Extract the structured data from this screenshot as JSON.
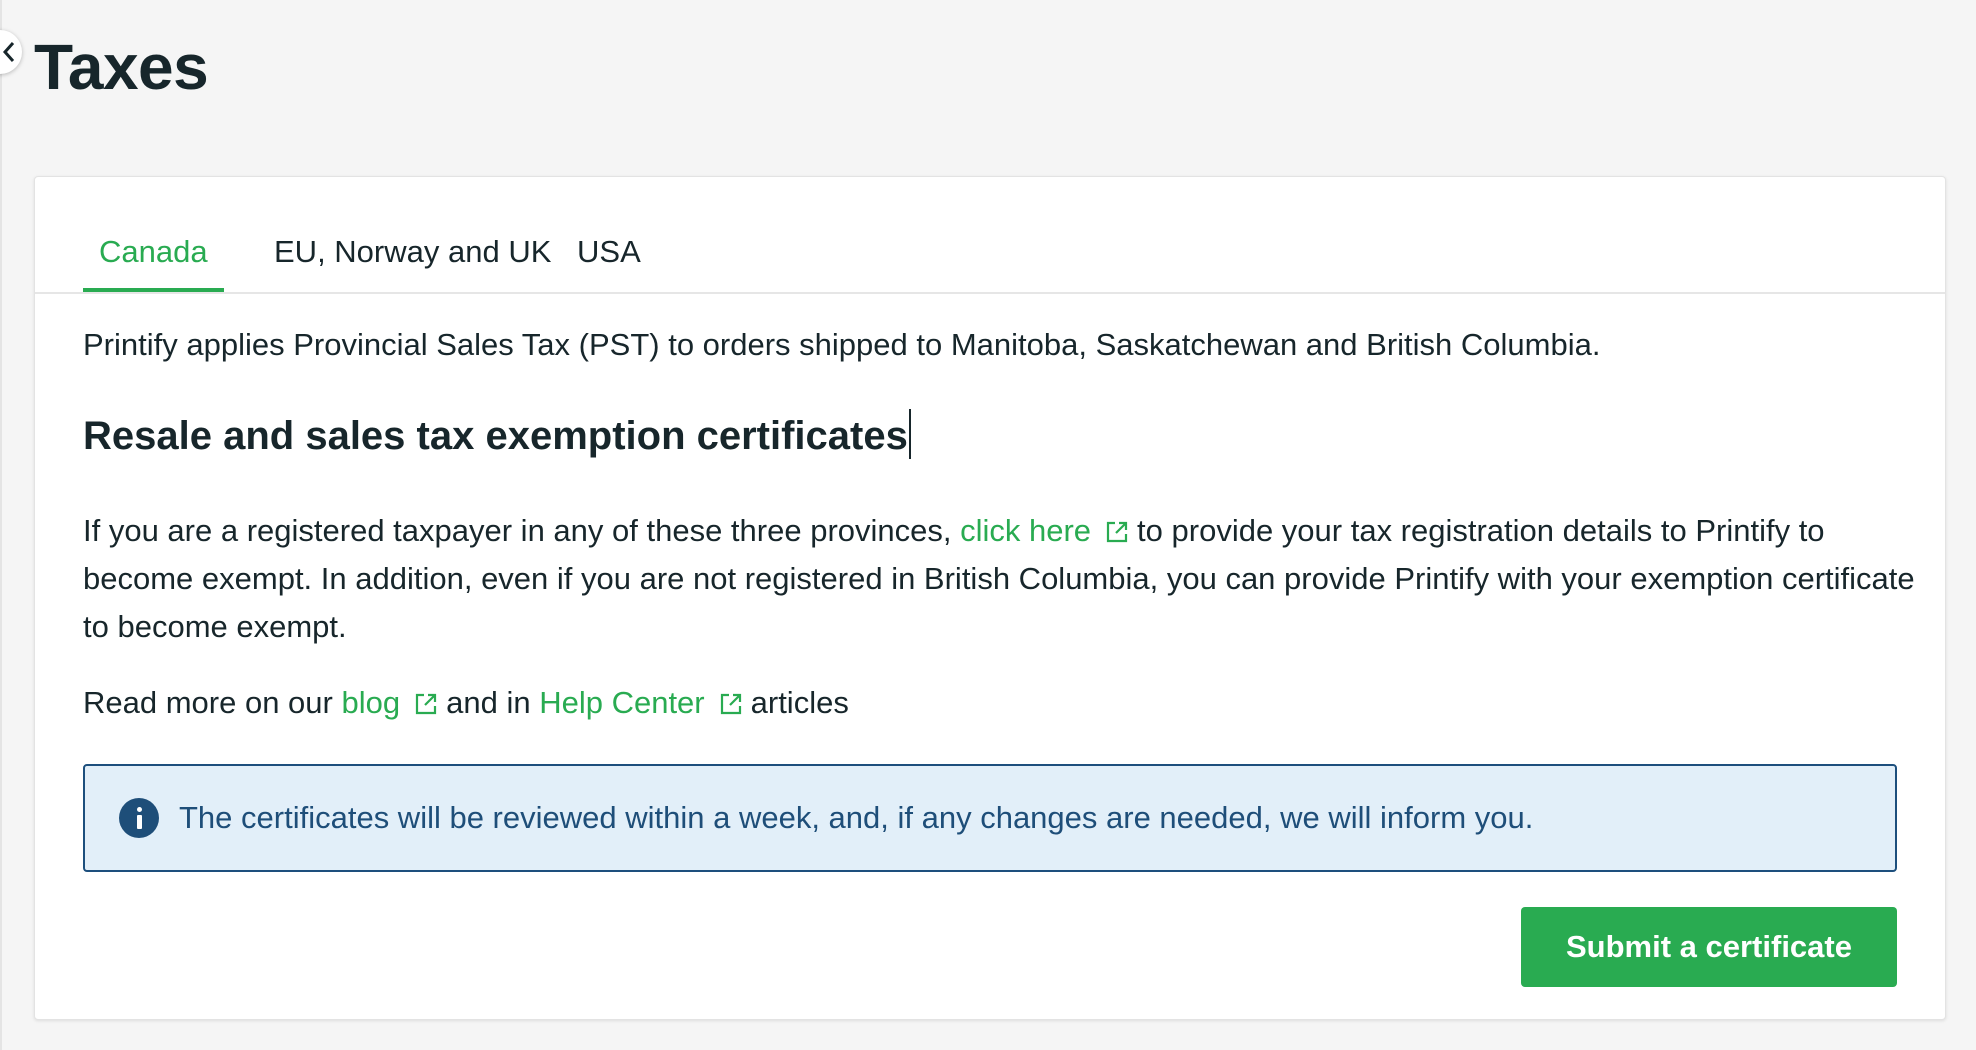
{
  "page": {
    "title": "Taxes"
  },
  "tabs": [
    {
      "label": "Canada",
      "active": true
    },
    {
      "label": "EU, Norway and UK",
      "active": false
    },
    {
      "label": "USA",
      "active": false
    }
  ],
  "content": {
    "intro": "Printify applies Provincial Sales Tax (PST) to orders shipped to Manitoba, Saskatchewan and British Columbia.",
    "section_title": "Resale and sales tax exemption certificates",
    "paragraph": {
      "before_link": "If you are a registered taxpayer in any of these three provinces,",
      "link_text": "click here",
      "after_link": "to provide your tax registration details to Printify to become exempt. In addition, even if you are not registered in British Columbia, you can provide Printify with your exemption certificate to become exempt."
    },
    "read_more": {
      "prefix": "Read more on our",
      "blog_link": "blog",
      "middle": "and in",
      "help_link": "Help Center",
      "suffix": "articles"
    },
    "info": "The certificates will be reviewed within a week, and, if any changes are needed, we will inform you.",
    "submit_label": "Submit a certificate"
  },
  "icons": {
    "collapse": "chevron-left-icon",
    "external": "external-link-icon",
    "info": "info-icon"
  },
  "colors": {
    "accent_green": "#29ab51",
    "text_dark": "#17262b",
    "info_bg": "#e2eff9",
    "info_border": "#1d4f7d",
    "info_text": "#1e4e79"
  }
}
